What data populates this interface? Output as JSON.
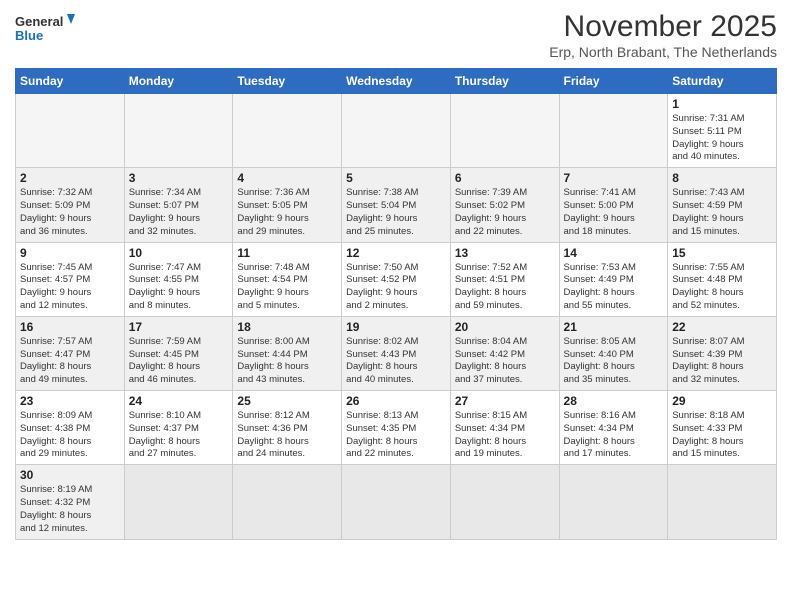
{
  "logo": {
    "general": "General",
    "blue": "Blue"
  },
  "title": "November 2025",
  "location": "Erp, North Brabant, The Netherlands",
  "weekdays": [
    "Sunday",
    "Monday",
    "Tuesday",
    "Wednesday",
    "Thursday",
    "Friday",
    "Saturday"
  ],
  "weeks": [
    [
      {
        "day": "",
        "info": ""
      },
      {
        "day": "",
        "info": ""
      },
      {
        "day": "",
        "info": ""
      },
      {
        "day": "",
        "info": ""
      },
      {
        "day": "",
        "info": ""
      },
      {
        "day": "",
        "info": ""
      },
      {
        "day": "1",
        "info": "Sunrise: 7:31 AM\nSunset: 5:11 PM\nDaylight: 9 hours\nand 40 minutes."
      }
    ],
    [
      {
        "day": "2",
        "info": "Sunrise: 7:32 AM\nSunset: 5:09 PM\nDaylight: 9 hours\nand 36 minutes."
      },
      {
        "day": "3",
        "info": "Sunrise: 7:34 AM\nSunset: 5:07 PM\nDaylight: 9 hours\nand 32 minutes."
      },
      {
        "day": "4",
        "info": "Sunrise: 7:36 AM\nSunset: 5:05 PM\nDaylight: 9 hours\nand 29 minutes."
      },
      {
        "day": "5",
        "info": "Sunrise: 7:38 AM\nSunset: 5:04 PM\nDaylight: 9 hours\nand 25 minutes."
      },
      {
        "day": "6",
        "info": "Sunrise: 7:39 AM\nSunset: 5:02 PM\nDaylight: 9 hours\nand 22 minutes."
      },
      {
        "day": "7",
        "info": "Sunrise: 7:41 AM\nSunset: 5:00 PM\nDaylight: 9 hours\nand 18 minutes."
      },
      {
        "day": "8",
        "info": "Sunrise: 7:43 AM\nSunset: 4:59 PM\nDaylight: 9 hours\nand 15 minutes."
      }
    ],
    [
      {
        "day": "9",
        "info": "Sunrise: 7:45 AM\nSunset: 4:57 PM\nDaylight: 9 hours\nand 12 minutes."
      },
      {
        "day": "10",
        "info": "Sunrise: 7:47 AM\nSunset: 4:55 PM\nDaylight: 9 hours\nand 8 minutes."
      },
      {
        "day": "11",
        "info": "Sunrise: 7:48 AM\nSunset: 4:54 PM\nDaylight: 9 hours\nand 5 minutes."
      },
      {
        "day": "12",
        "info": "Sunrise: 7:50 AM\nSunset: 4:52 PM\nDaylight: 9 hours\nand 2 minutes."
      },
      {
        "day": "13",
        "info": "Sunrise: 7:52 AM\nSunset: 4:51 PM\nDaylight: 8 hours\nand 59 minutes."
      },
      {
        "day": "14",
        "info": "Sunrise: 7:53 AM\nSunset: 4:49 PM\nDaylight: 8 hours\nand 55 minutes."
      },
      {
        "day": "15",
        "info": "Sunrise: 7:55 AM\nSunset: 4:48 PM\nDaylight: 8 hours\nand 52 minutes."
      }
    ],
    [
      {
        "day": "16",
        "info": "Sunrise: 7:57 AM\nSunset: 4:47 PM\nDaylight: 8 hours\nand 49 minutes."
      },
      {
        "day": "17",
        "info": "Sunrise: 7:59 AM\nSunset: 4:45 PM\nDaylight: 8 hours\nand 46 minutes."
      },
      {
        "day": "18",
        "info": "Sunrise: 8:00 AM\nSunset: 4:44 PM\nDaylight: 8 hours\nand 43 minutes."
      },
      {
        "day": "19",
        "info": "Sunrise: 8:02 AM\nSunset: 4:43 PM\nDaylight: 8 hours\nand 40 minutes."
      },
      {
        "day": "20",
        "info": "Sunrise: 8:04 AM\nSunset: 4:42 PM\nDaylight: 8 hours\nand 37 minutes."
      },
      {
        "day": "21",
        "info": "Sunrise: 8:05 AM\nSunset: 4:40 PM\nDaylight: 8 hours\nand 35 minutes."
      },
      {
        "day": "22",
        "info": "Sunrise: 8:07 AM\nSunset: 4:39 PM\nDaylight: 8 hours\nand 32 minutes."
      }
    ],
    [
      {
        "day": "23",
        "info": "Sunrise: 8:09 AM\nSunset: 4:38 PM\nDaylight: 8 hours\nand 29 minutes."
      },
      {
        "day": "24",
        "info": "Sunrise: 8:10 AM\nSunset: 4:37 PM\nDaylight: 8 hours\nand 27 minutes."
      },
      {
        "day": "25",
        "info": "Sunrise: 8:12 AM\nSunset: 4:36 PM\nDaylight: 8 hours\nand 24 minutes."
      },
      {
        "day": "26",
        "info": "Sunrise: 8:13 AM\nSunset: 4:35 PM\nDaylight: 8 hours\nand 22 minutes."
      },
      {
        "day": "27",
        "info": "Sunrise: 8:15 AM\nSunset: 4:34 PM\nDaylight: 8 hours\nand 19 minutes."
      },
      {
        "day": "28",
        "info": "Sunrise: 8:16 AM\nSunset: 4:34 PM\nDaylight: 8 hours\nand 17 minutes."
      },
      {
        "day": "29",
        "info": "Sunrise: 8:18 AM\nSunset: 4:33 PM\nDaylight: 8 hours\nand 15 minutes."
      }
    ],
    [
      {
        "day": "30",
        "info": "Sunrise: 8:19 AM\nSunset: 4:32 PM\nDaylight: 8 hours\nand 12 minutes."
      },
      {
        "day": "",
        "info": ""
      },
      {
        "day": "",
        "info": ""
      },
      {
        "day": "",
        "info": ""
      },
      {
        "day": "",
        "info": ""
      },
      {
        "day": "",
        "info": ""
      },
      {
        "day": "",
        "info": ""
      }
    ]
  ]
}
